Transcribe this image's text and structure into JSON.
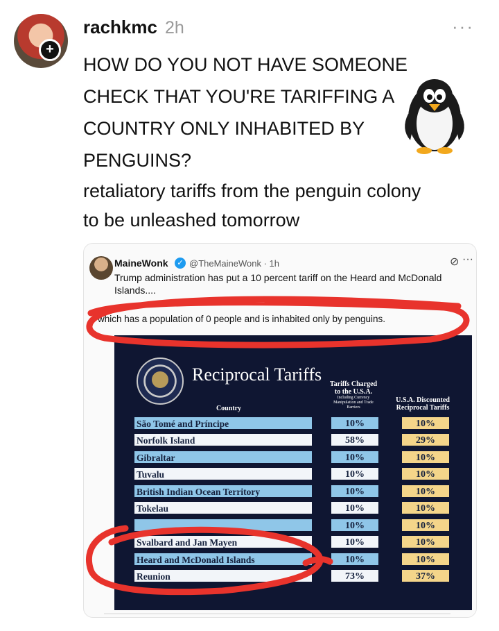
{
  "post": {
    "username": "rachkmc",
    "timestamp": "2h",
    "more_icon": "more-dots-icon",
    "main_text": "HOW DO YOU NOT HAVE SOMEONE\nCHECK THAT YOU'RE TARIFFING A\nCOUNTRY ONLY INHABITED BY\nPENGUINS?",
    "emoji": "penguin",
    "sub_text": "retaliatory tariffs from the penguin colony\nto be unleashed tomorrow"
  },
  "quoted_tweet": {
    "name": "MaineWonk",
    "handle": "@TheMaineWonk · 1h",
    "text": "Trump administration has put a 10 percent tariff on the Heard and McDonald Islands....",
    "highlight": "which has a population of 0 people and is inhabited only by penguins."
  },
  "tariff_table": {
    "title": "Reciprocal Tariffs",
    "col_country": "Country",
    "col_charged": "Tariffs Charged to the U.S.A.",
    "col_charged_note": "Including Currency Manipulation and Trade Barriers",
    "col_discount": "U.S.A. Discounted Reciprocal Tariffs",
    "rows": [
      {
        "country": "São Tomé and Príncipe",
        "charged": "10%",
        "discount": "10%"
      },
      {
        "country": "Norfolk Island",
        "charged": "58%",
        "discount": "29%"
      },
      {
        "country": "Gibraltar",
        "charged": "10%",
        "discount": "10%"
      },
      {
        "country": "Tuvalu",
        "charged": "10%",
        "discount": "10%"
      },
      {
        "country": "British Indian Ocean Territory",
        "charged": "10%",
        "discount": "10%"
      },
      {
        "country": "Tokelau",
        "charged": "10%",
        "discount": "10%"
      },
      {
        "country": "",
        "charged": "10%",
        "discount": "10%"
      },
      {
        "country": "Svalbard and Jan Mayen",
        "charged": "10%",
        "discount": "10%"
      },
      {
        "country": "Heard and McDonald Islands",
        "charged": "10%",
        "discount": "10%"
      },
      {
        "country": "Reunion",
        "charged": "73%",
        "discount": "37%"
      }
    ]
  },
  "colors": {
    "annotation_red": "#e8332c",
    "table_bg": "#0f1632",
    "row_blue": "#8fc6e8",
    "row_gold": "#f4d58a"
  }
}
